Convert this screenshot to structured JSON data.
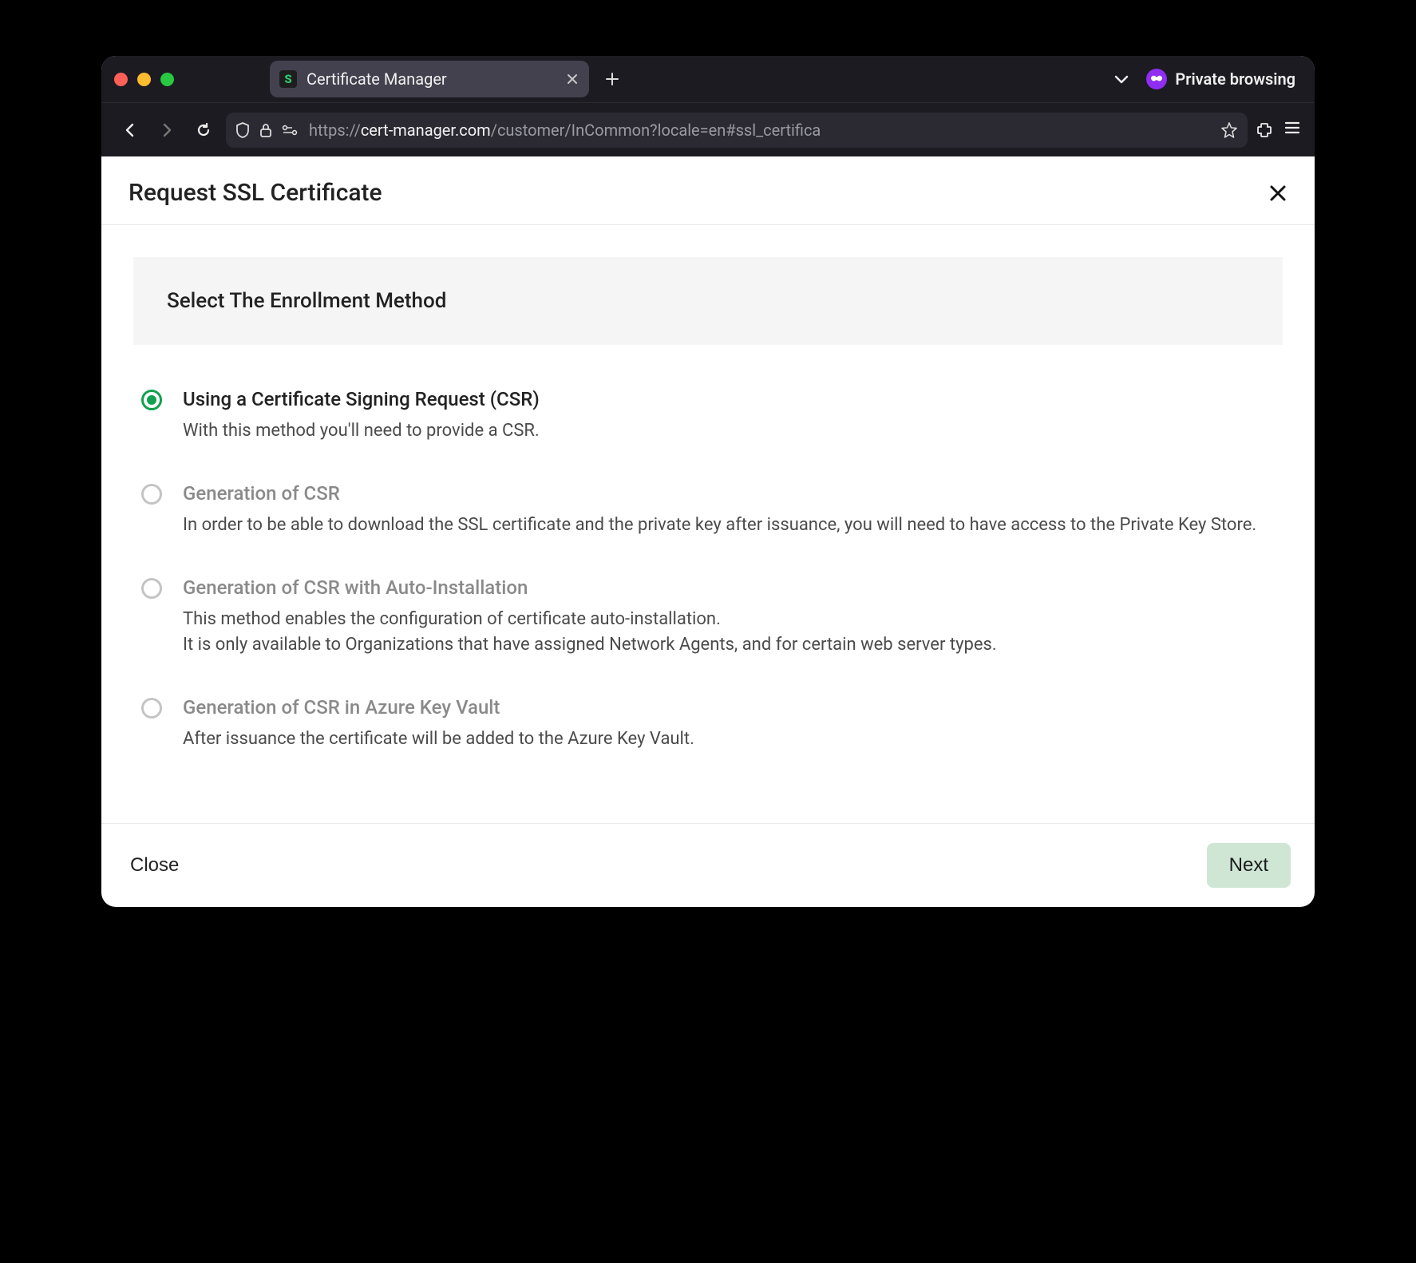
{
  "browser": {
    "tab_title": "Certificate Manager",
    "favicon_letter": "S",
    "url_prefix": "https://",
    "url_host": "cert-manager.com",
    "url_path": "/customer/InCommon?locale=en#ssl_certifica",
    "private_label": "Private browsing"
  },
  "page": {
    "title": "Request SSL Certificate",
    "section_heading": "Select The Enrollment Method",
    "close_label": "Close",
    "next_label": "Next"
  },
  "options": [
    {
      "title": "Using a Certificate Signing Request (CSR)",
      "desc": "With this method you'll need to provide a CSR.",
      "selected": true
    },
    {
      "title": "Generation of CSR",
      "desc": "In order to be able to download the SSL certificate and the private key after issuance, you will need to have access to the Private Key Store.",
      "selected": false
    },
    {
      "title": "Generation of CSR with Auto-Installation",
      "desc": "This method enables the configuration of certificate auto-installation.\nIt is only available to Organizations that have assigned Network Agents, and for certain web server types.",
      "selected": false
    },
    {
      "title": "Generation of CSR in Azure Key Vault",
      "desc": "After issuance the certificate will be added to the Azure Key Vault.",
      "selected": false
    }
  ]
}
